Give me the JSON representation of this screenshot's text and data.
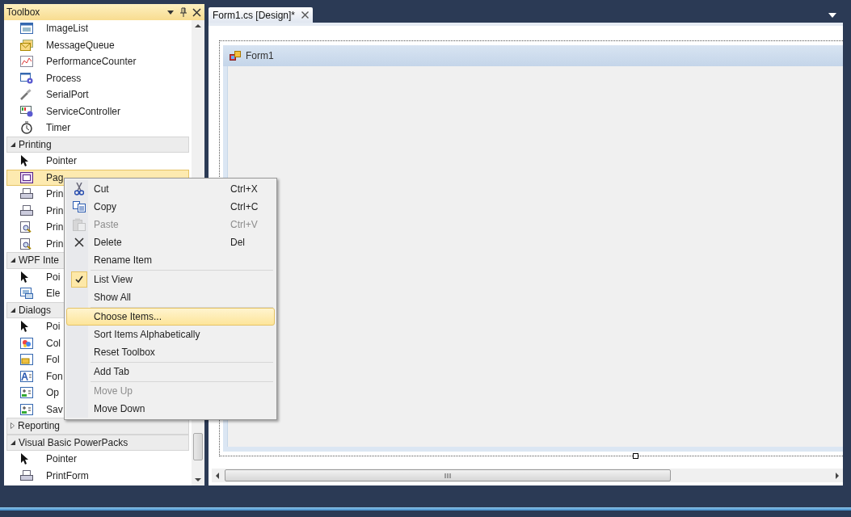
{
  "toolbox": {
    "title": "Toolbox",
    "rows": [
      {
        "kind": "item",
        "label": "ImageList",
        "selected": false
      },
      {
        "kind": "item",
        "label": "MessageQueue",
        "selected": false
      },
      {
        "kind": "item",
        "label": "PerformanceCounter",
        "selected": false
      },
      {
        "kind": "item",
        "label": "Process",
        "selected": false
      },
      {
        "kind": "item",
        "label": "SerialPort",
        "selected": false
      },
      {
        "kind": "item",
        "label": "ServiceController",
        "selected": false
      },
      {
        "kind": "item",
        "label": "Timer",
        "selected": false
      },
      {
        "kind": "category",
        "label": "Printing",
        "expanded": true
      },
      {
        "kind": "item",
        "label": "Pointer",
        "selected": false
      },
      {
        "kind": "item",
        "label": "Pag",
        "selected": true
      },
      {
        "kind": "item",
        "label": "Prin",
        "selected": false
      },
      {
        "kind": "item",
        "label": "Prin",
        "selected": false
      },
      {
        "kind": "item",
        "label": "Prin",
        "selected": false
      },
      {
        "kind": "item",
        "label": "Prin",
        "selected": false
      },
      {
        "kind": "category",
        "label": "WPF Inte",
        "expanded": true
      },
      {
        "kind": "item",
        "label": "Poi",
        "selected": false
      },
      {
        "kind": "item",
        "label": "Ele",
        "selected": false
      },
      {
        "kind": "category",
        "label": "Dialogs",
        "expanded": true
      },
      {
        "kind": "item",
        "label": "Poi",
        "selected": false
      },
      {
        "kind": "item",
        "label": "Col",
        "selected": false
      },
      {
        "kind": "item",
        "label": "Fol",
        "selected": false
      },
      {
        "kind": "item",
        "label": "Fon",
        "selected": false
      },
      {
        "kind": "item",
        "label": "Op",
        "selected": false
      },
      {
        "kind": "item",
        "label": "Sav",
        "selected": false
      },
      {
        "kind": "category",
        "label": "Reporting",
        "expanded": false
      },
      {
        "kind": "category",
        "label": "Visual Basic PowerPacks",
        "expanded": true
      },
      {
        "kind": "item",
        "label": "Pointer",
        "selected": false
      },
      {
        "kind": "item",
        "label": "PrintForm",
        "selected": false
      }
    ]
  },
  "document": {
    "tabs": [
      {
        "label": "Form1.cs [Design]*",
        "selected": true
      }
    ],
    "form": {
      "title": "Form1"
    }
  },
  "context_menu": [
    {
      "kind": "item",
      "label": "Cut",
      "shortcut": "Ctrl+X",
      "disabled": false,
      "checked": false,
      "selected": false
    },
    {
      "kind": "item",
      "label": "Copy",
      "shortcut": "Ctrl+C",
      "disabled": false,
      "checked": false,
      "selected": false
    },
    {
      "kind": "item",
      "label": "Paste",
      "shortcut": "Ctrl+V",
      "disabled": true,
      "checked": false,
      "selected": false
    },
    {
      "kind": "item",
      "label": "Delete",
      "shortcut": "Del",
      "disabled": false,
      "checked": false,
      "selected": false
    },
    {
      "kind": "item",
      "label": "Rename Item",
      "disabled": false,
      "checked": false,
      "selected": false
    },
    {
      "kind": "separator"
    },
    {
      "kind": "item",
      "label": "List View",
      "disabled": false,
      "checked": true,
      "selected": false
    },
    {
      "kind": "item",
      "label": "Show All",
      "disabled": false,
      "checked": false,
      "selected": false
    },
    {
      "kind": "separator"
    },
    {
      "kind": "item",
      "label": "Choose Items...",
      "disabled": false,
      "checked": false,
      "selected": true
    },
    {
      "kind": "item",
      "label": "Sort Items Alphabetically",
      "disabled": false,
      "checked": false,
      "selected": false
    },
    {
      "kind": "item",
      "label": "Reset Toolbox",
      "disabled": false,
      "checked": false,
      "selected": false
    },
    {
      "kind": "separator"
    },
    {
      "kind": "item",
      "label": "Add Tab",
      "disabled": false,
      "checked": false,
      "selected": false
    },
    {
      "kind": "separator"
    },
    {
      "kind": "item",
      "label": "Move Up",
      "disabled": true,
      "checked": false,
      "selected": false
    },
    {
      "kind": "item",
      "label": "Move Down",
      "disabled": false,
      "checked": false,
      "selected": false
    }
  ]
}
